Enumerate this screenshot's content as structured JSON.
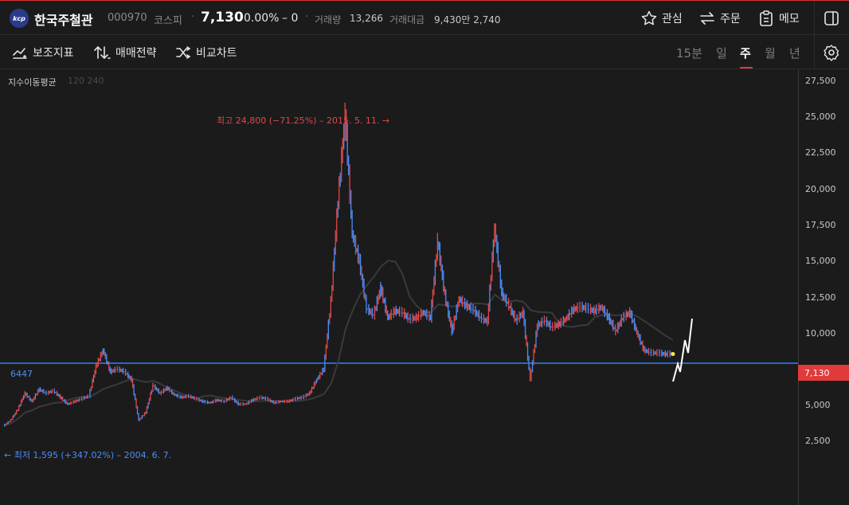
{
  "header": {
    "logo_text": "kcp",
    "name": "한국주철관",
    "code": "000970",
    "market": "코스피",
    "price": "7,130",
    "rate": "0.00%",
    "change": "– 0",
    "volume_label": "거래량",
    "volume": "13,266",
    "amount_label": "거래대금",
    "amount": "9,430만 2,740",
    "actions": {
      "favorite": "관심",
      "order": "주문",
      "memo": "메모"
    }
  },
  "toolbar": {
    "indicators": "보조지표",
    "strategy": "매매전략",
    "compare": "비교차트",
    "periods": [
      "15분",
      "일",
      "주",
      "월",
      "년"
    ],
    "active_period": "주"
  },
  "chart": {
    "ma_label": "지수이동평균",
    "ma_periods": "120 240",
    "y_ticks": [
      "27,500",
      "25,000",
      "22,500",
      "20,000",
      "17,500",
      "15,000",
      "12,500",
      "10,000",
      "7,130",
      "5,000",
      "2,500"
    ],
    "current_price": "7,130",
    "horizontal_line_label": "6447",
    "high_label": "최고 24,800 (−71.25%) – 2015. 5. 11. →",
    "low_label": "← 최저 1,595 (+347.02%) – 2004. 6. 7.",
    "colors": {
      "up": "#e04848",
      "down": "#4c8df6",
      "line": "#2f7ae5",
      "current_tag": "#e03a3a"
    }
  },
  "chart_data": {
    "type": "line",
    "title": "",
    "xlabel": "",
    "ylabel": "",
    "ylim": [
      0,
      27500
    ],
    "horizontal_line": 6447,
    "current": 7130,
    "high": {
      "value": 24800,
      "date": "2015. 5. 11."
    },
    "low": {
      "value": 1595,
      "date": "2004. 6. 7."
    },
    "series": [
      {
        "values": [
          1800,
          2200,
          3000,
          4200,
          3600,
          4500,
          4200,
          4400,
          3900,
          3400,
          3600,
          3800,
          4000,
          6200,
          7400,
          5800,
          6000,
          5800,
          5200,
          2200,
          2800,
          4800,
          4200,
          4600,
          4100,
          3900,
          4000,
          3800,
          3600,
          3500,
          3700,
          3600,
          3900,
          3400,
          3400,
          3700,
          3900,
          3800,
          3500,
          3600,
          3600,
          3800,
          3900,
          4200,
          5200,
          6000,
          11000,
          18500,
          24800,
          16000,
          14000,
          10500,
          10000,
          12000,
          9800,
          10300,
          10200,
          9700,
          9800,
          10200,
          9800,
          15500,
          11500,
          8800,
          11200,
          10700,
          10400,
          9800,
          9500,
          16500,
          11600,
          10700,
          9600,
          10200,
          5200,
          9200,
          9600,
          9100,
          9300,
          9700,
          10400,
          10600,
          10500,
          10300,
          10600,
          9800,
          8800,
          9800,
          10200,
          8700,
          7400,
          7200,
          7200,
          7100,
          7130
        ]
      }
    ]
  }
}
